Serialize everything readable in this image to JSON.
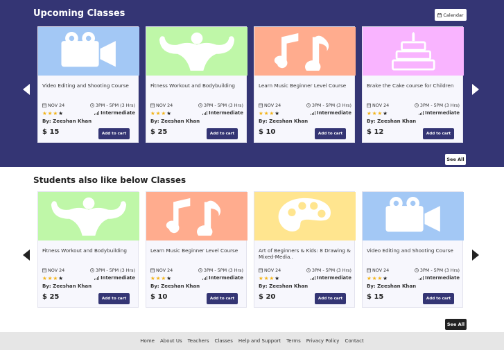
{
  "upcoming": {
    "title": "Upcoming Classes",
    "calendar_label": "Calendar",
    "see_all_label": "See All",
    "cards": [
      {
        "title": "Video Editing and Shooting Course",
        "date": "NOV 24",
        "time": "3PM - 5PM (3 Hrs)",
        "level": "Intermediate",
        "author": "By: Zeeshan Khan",
        "price": "$ 15",
        "cart_label": "Add to cart",
        "thumb_color": "#a3c8f5",
        "icon": "video-camera-icon",
        "rating": 3
      },
      {
        "title": "Fitness Workout and Bodybuilding",
        "date": "NOV 24",
        "time": "3PM - 5PM (3 Hrs)",
        "level": "Intermediate",
        "author": "By: Zeeshan Khan",
        "price": "$ 25",
        "cart_label": "Add to cart",
        "thumb_color": "#bff7a8",
        "icon": "bodybuilder-icon",
        "rating": 3
      },
      {
        "title": "Learn Music Beginner Level Course",
        "date": "NOV 24",
        "time": "3PM - 5PM (3 Hrs)",
        "level": "Intermediate",
        "author": "By: Zeeshan Khan",
        "price": "$ 10",
        "cart_label": "Add to cart",
        "thumb_color": "#ffac8e",
        "icon": "music-note-icon",
        "rating": 3
      },
      {
        "title": "Brake the Cake course for Children",
        "date": "NOV 24",
        "time": "3PM - 5PM (3 Hrs)",
        "level": "Intermediate",
        "author": "By: Zeeshan Khan",
        "price": "$ 12",
        "cart_label": "Add to cart",
        "thumb_color": "#f9b4ff",
        "icon": "birthday-cake-icon",
        "rating": 3
      }
    ]
  },
  "also_like": {
    "title": "Students also like below Classes",
    "see_all_label": "See All",
    "cards": [
      {
        "title": "Fitness Workout and Bodybuilding",
        "date": "NOV 24",
        "time": "3PM - 5PM (3 Hrs)",
        "level": "Intermediate",
        "author": "By: Zeeshan Khan",
        "price": "$ 25",
        "cart_label": "Add to cart",
        "thumb_color": "#bff7a8",
        "icon": "bodybuilder-icon",
        "rating": 3
      },
      {
        "title": "Learn Music Beginner Level Course",
        "date": "NOV 24",
        "time": "3PM - 5PM (3 Hrs)",
        "level": "Intermediate",
        "author": "By: Zeeshan Khan",
        "price": "$ 10",
        "cart_label": "Add to cart",
        "thumb_color": "#ffac8e",
        "icon": "music-note-icon",
        "rating": 3
      },
      {
        "title": "Art of Beginners & Kids: 8 Drawing & Mixed-Media..",
        "date": "NOV 24",
        "time": "3PM - 5PM (3 Hrs)",
        "level": "Intermediate",
        "author": "By: Zeeshan Khan",
        "price": "$ 20",
        "cart_label": "Add to cart",
        "thumb_color": "#ffe58f",
        "icon": "paint-palette-icon",
        "rating": 3
      },
      {
        "title": "Video Editing and Shooting Course",
        "date": "NOV 24",
        "time": "3PM - 5PM (3 Hrs)",
        "level": "Intermediate",
        "author": "By: Zeeshan Khan",
        "price": "$ 15",
        "cart_label": "Add to cart",
        "thumb_color": "#a3c8f5",
        "icon": "video-camera-icon",
        "rating": 3
      }
    ]
  },
  "footer": {
    "links": [
      "Home",
      "About Us",
      "Teachers",
      "Classes",
      "Help and Support",
      "Terms",
      "Privacy Policy",
      "Contact"
    ]
  },
  "colors": {
    "accent": "#343574",
    "star": "#f3b316"
  }
}
